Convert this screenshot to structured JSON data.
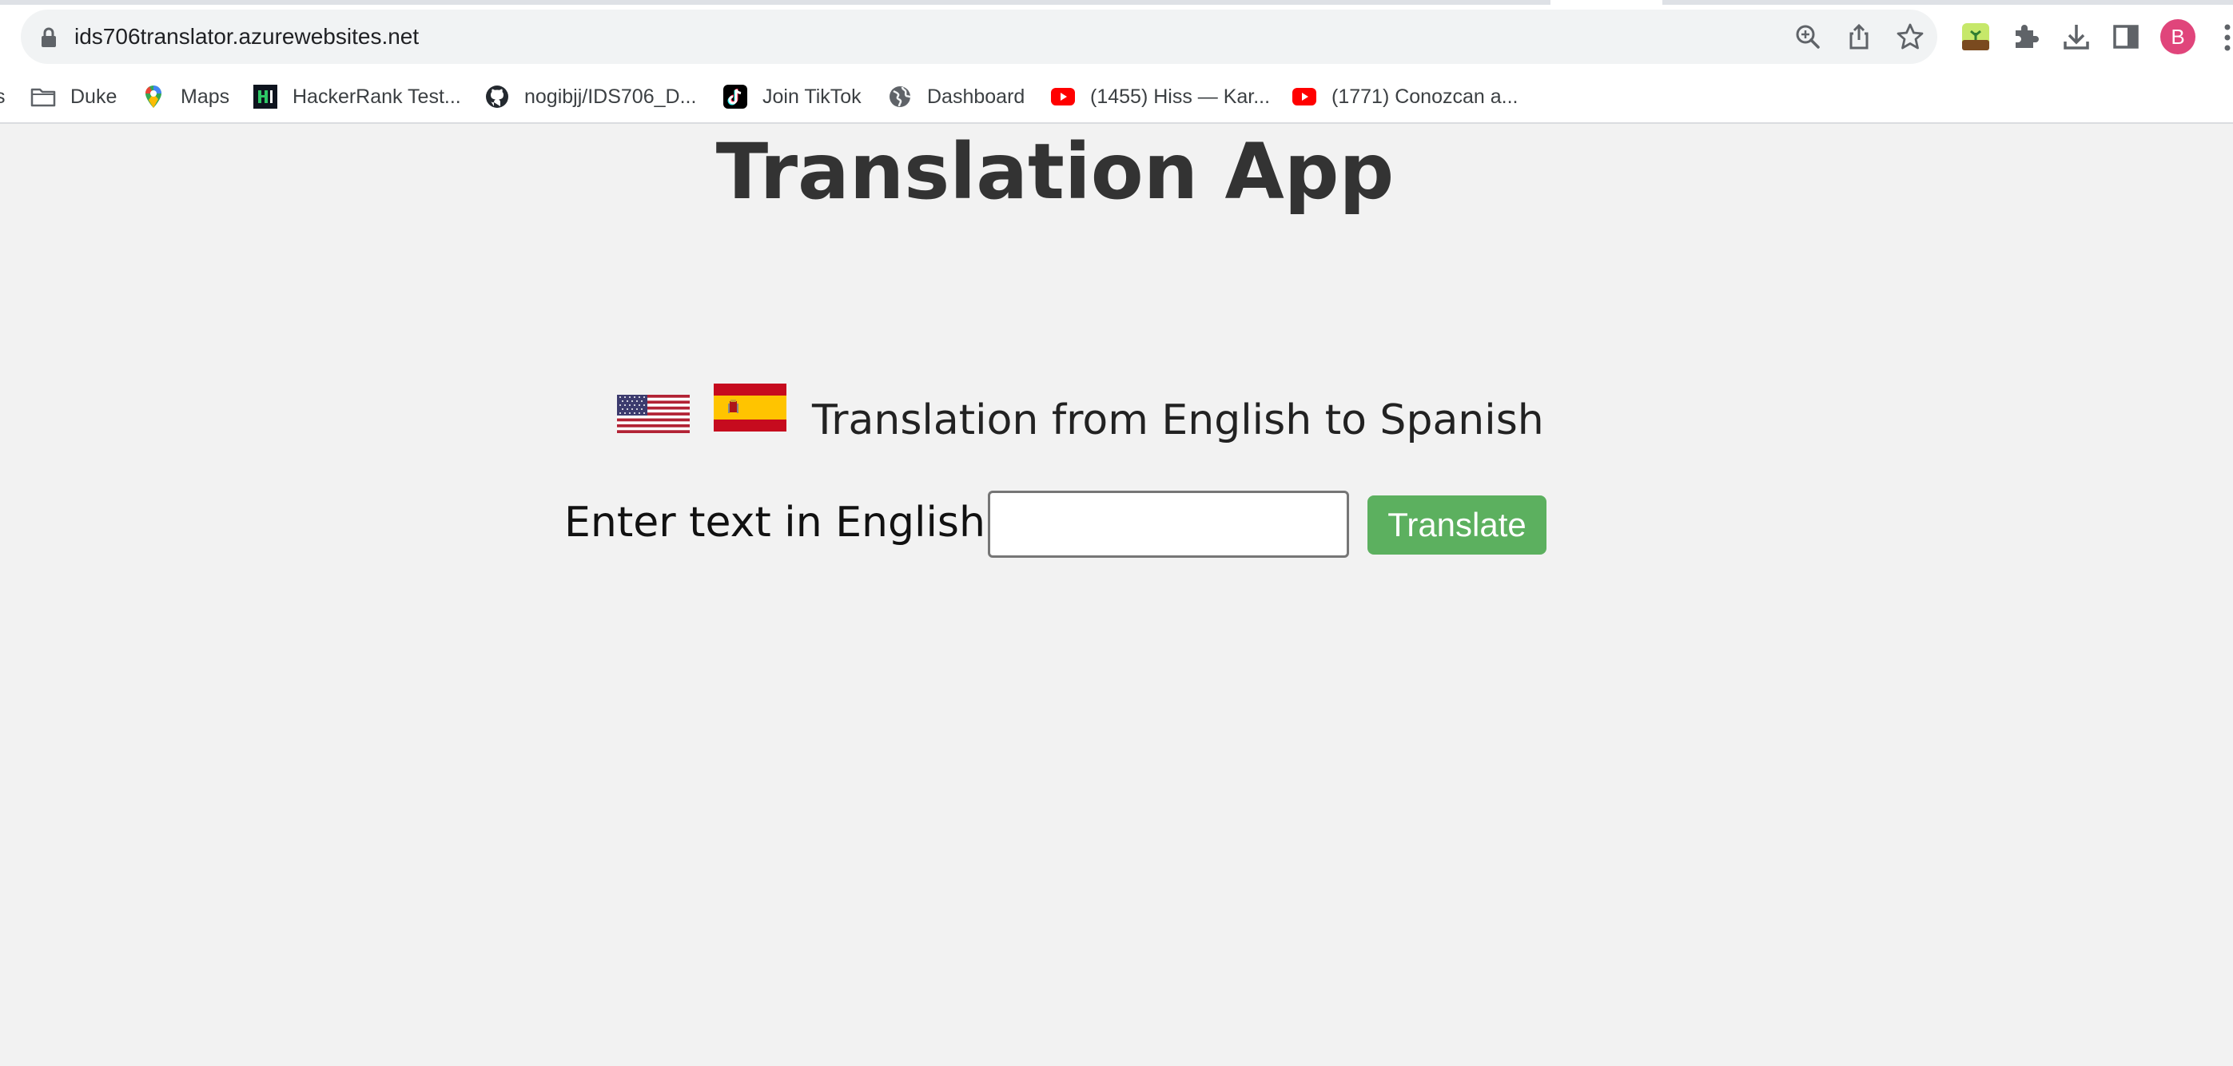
{
  "browser": {
    "url": "ids706translator.azurewebsites.net",
    "profile_initial": "B",
    "bookmarks_partial": "s",
    "bookmarks": [
      {
        "label": "Duke",
        "icon": "folder-icon"
      },
      {
        "label": "Maps",
        "icon": "google-maps-icon"
      },
      {
        "label": "HackerRank Test...",
        "icon": "hackerrank-icon"
      },
      {
        "label": "nogibjj/IDS706_D...",
        "icon": "github-icon"
      },
      {
        "label": "Join TikTok",
        "icon": "tiktok-icon"
      },
      {
        "label": "Dashboard",
        "icon": "globe-icon"
      },
      {
        "label": "(1455) Hiss — Kar...",
        "icon": "youtube-icon"
      },
      {
        "label": "(1771) Conozcan a...",
        "icon": "youtube-icon"
      }
    ],
    "toolbar_icons": [
      "zoom-icon",
      "share-icon",
      "bookmark-star-icon",
      "extension-app-icon",
      "puzzle-extensions-icon",
      "download-icon",
      "side-panel-icon",
      "kebab-menu-icon"
    ]
  },
  "app": {
    "title": "Translation App",
    "subtitle": "Translation from English to Spanish",
    "input_label": "Enter text in English:",
    "input_value": "",
    "button_label": "Translate",
    "colors": {
      "background": "#f2f2f2",
      "title": "#333333",
      "button": "#5cb05f"
    }
  }
}
